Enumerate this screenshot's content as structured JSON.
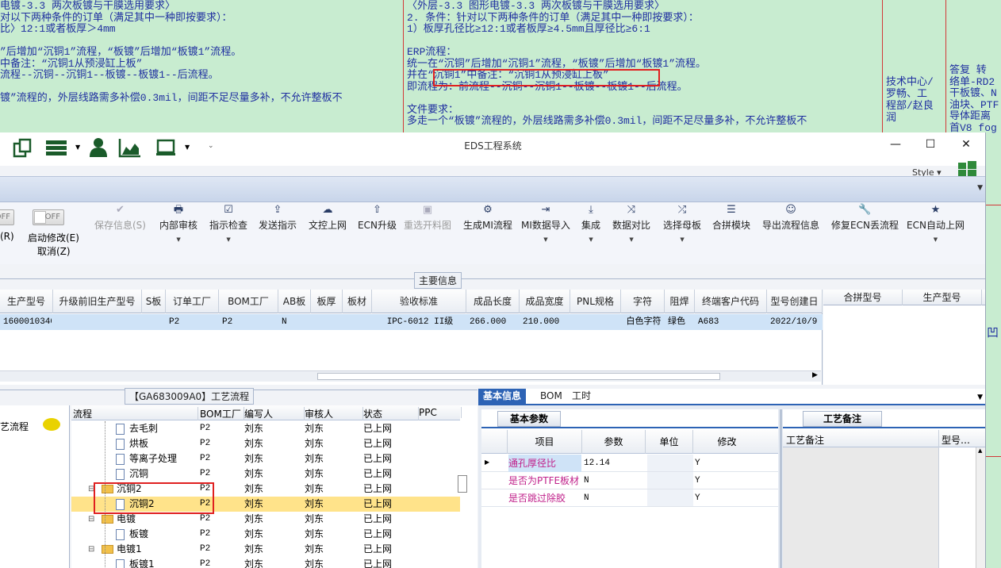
{
  "background": {
    "left_lines": [
      "电镀-3.3 两次板镀与干膜选用要求〉",
      "对以下两种条件的订单（满足其中一种即按要求）：",
      "比〉12:1或者板厚＞4mm",
      "",
      "”后增加“沉铜1”流程，“板镀”后增加“板镀1”流程。",
      " 中备注：“沉铜1从预浸缸上板”",
      "流程--沉铜--沉铜1--板镀--板镀1--后流程。",
      "",
      "镀”流程的，外层线路需多补偿0.3mil，间距不足尽量多补，不允许整板不"
    ],
    "mid_lines": [
      "〈外层-3.3 图形电镀-3.3 两次板镀与干膜选用要求〉",
      "2. 条件：针对以下两种条件的订单（满足其中一种即按要求）：",
      "1）板厚孔径比≥12:1或者板厚≥4.5mm且厚径比≥6:1",
      "",
      "ERP流程：",
      "统一在“沉铜”后增加“沉铜1”流程，“板镀”后增加“板镀1”流程。",
      "并在“沉铜1”中备注：“沉铜1从预浸缸上板”",
      "即流程为：前流程--沉铜--沉铜1--板镀--板镀1--后流程。",
      "",
      "文件要求：",
      "多走一个“板镀”流程的，外层线路需多补偿0.3mil，间距不足尽量多补，不允许整板不"
    ],
    "owner_lines": [
      "技术中心/",
      "罗畅、工",
      "程部/赵良",
      "润"
    ],
    "right_lines": [
      "答复  转",
      "络单-RD2",
      "干板镀、N",
      "油块、PTF",
      "导体距离",
      "首V8 fog"
    ],
    "far_right_char": "凹"
  },
  "window": {
    "title": "EDS工程系统",
    "minimize": "—",
    "maximize": "☐",
    "close": "✕",
    "style_label": "Style ▾"
  },
  "toolbar": {
    "toggle_off_1": "OFF",
    "toggle_off_2": "OFF",
    "left_cut_label": "(R)",
    "startup_modify": "启动修改(E)",
    "cancel": "取消(Z)",
    "buttons": [
      {
        "label": "保存信息(S)",
        "icon": "✔"
      },
      {
        "label": "内部审核",
        "icon": "🖶"
      },
      {
        "label": "指示检查",
        "icon": "☑"
      },
      {
        "label": "发送指示",
        "icon": "⇪"
      },
      {
        "label": "文控上网",
        "icon": "☁"
      },
      {
        "label": "ECN升级",
        "icon": "⇧"
      },
      {
        "label": "重选开料图",
        "icon": "▣"
      },
      {
        "label": "生成MI流程",
        "icon": "⚙"
      },
      {
        "label": "MI数据导入",
        "icon": "⇥"
      },
      {
        "label": "集成",
        "icon": "⤓"
      },
      {
        "label": "数据对比",
        "icon": "⤨"
      },
      {
        "label": "选择母板",
        "icon": "⤮"
      },
      {
        "label": "合拼模块",
        "icon": "☰"
      },
      {
        "label": "导出流程信息",
        "icon": "☺"
      },
      {
        "label": "修复ECN丢流程",
        "icon": "🔧"
      },
      {
        "label": "ECN自动上网",
        "icon": "★"
      }
    ]
  },
  "main_info": {
    "section_title": "主要信息",
    "columns": [
      "生产型号",
      "升级前旧生产型号",
      "S板",
      "订单工厂",
      "BOM工厂",
      "AB板",
      "板厚",
      "板材",
      "验收标准",
      "成品长度",
      "成品宽度",
      "PNL规格",
      "字符",
      "阻焊",
      "终端客户代码",
      "型号创建日"
    ],
    "row": [
      "1600010340",
      "",
      "",
      "P2",
      "P2",
      "N",
      "",
      "",
      "IPC-6012 II级",
      "266.000",
      "210.000",
      "",
      "白色字符",
      "绿色",
      "A683",
      "2022/10/9"
    ],
    "side_columns": [
      "合拼型号",
      "生产型号"
    ]
  },
  "process": {
    "section_title": "【GA683009A0】工艺流程",
    "left_item": "艺流程",
    "columns": [
      "流程",
      "BOM工厂",
      "编写人",
      "审核人",
      "状态",
      "PPC"
    ],
    "rows": [
      {
        "name": "去毛刺",
        "factory": "P2",
        "writer": "刘东",
        "reviewer": "刘东",
        "status": "已上网",
        "folder": false,
        "level": 2
      },
      {
        "name": "烘板",
        "factory": "P2",
        "writer": "刘东",
        "reviewer": "刘东",
        "status": "已上网",
        "folder": false,
        "level": 2
      },
      {
        "name": "等离子处理",
        "factory": "P2",
        "writer": "刘东",
        "reviewer": "刘东",
        "status": "已上网",
        "folder": false,
        "level": 2
      },
      {
        "name": "沉铜",
        "factory": "P2",
        "writer": "刘东",
        "reviewer": "刘东",
        "status": "已上网",
        "folder": false,
        "level": 2
      },
      {
        "name": "沉铜2",
        "factory": "P2",
        "writer": "刘东",
        "reviewer": "刘东",
        "status": "已上网",
        "folder": true,
        "level": 1
      },
      {
        "name": "沉铜2",
        "factory": "P2",
        "writer": "刘东",
        "reviewer": "刘东",
        "status": "已上网",
        "folder": false,
        "level": 2,
        "selected": true
      },
      {
        "name": "电镀",
        "factory": "P2",
        "writer": "刘东",
        "reviewer": "刘东",
        "status": "已上网",
        "folder": true,
        "level": 1
      },
      {
        "name": "板镀",
        "factory": "P2",
        "writer": "刘东",
        "reviewer": "刘东",
        "status": "已上网",
        "folder": false,
        "level": 2
      },
      {
        "name": "电镀1",
        "factory": "P2",
        "writer": "刘东",
        "reviewer": "刘东",
        "status": "已上网",
        "folder": true,
        "level": 1
      },
      {
        "name": "板镀1",
        "factory": "P2",
        "writer": "刘东",
        "reviewer": "刘东",
        "status": "已上网",
        "folder": false,
        "level": 2
      }
    ]
  },
  "details": {
    "tabs": [
      "基本信息",
      "BOM",
      "工时"
    ],
    "sub_tab": "基本参数",
    "columns": [
      "项目",
      "参数",
      "单位",
      "修改"
    ],
    "rows": [
      {
        "item": "通孔厚径比",
        "value": "12.14",
        "unit": "",
        "modify": "Y"
      },
      {
        "item": "是否为PTFE板材",
        "value": "N",
        "unit": "",
        "modify": "Y"
      },
      {
        "item": "是否跳过除胶",
        "value": "N",
        "unit": "",
        "modify": "Y"
      }
    ]
  },
  "remarks": {
    "tab": "工艺备注",
    "columns": [
      "工艺备注",
      "型号…"
    ]
  }
}
